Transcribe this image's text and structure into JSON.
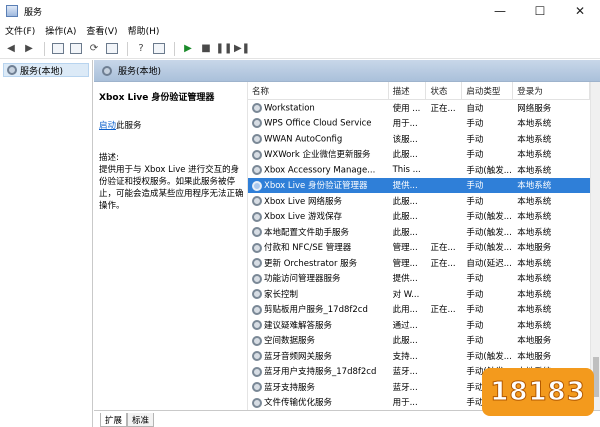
{
  "window": {
    "title": "服务",
    "min": "—",
    "max": "☐",
    "close": "✕"
  },
  "menu": [
    "文件(F)",
    "操作(A)",
    "查看(V)",
    "帮助(H)"
  ],
  "toolbar_icons": [
    "back-arrow-icon",
    "forward-arrow-icon",
    "console-tree-icon",
    "properties-icon",
    "refresh-icon",
    "export-list-icon",
    "help-icon",
    "show-hide-icon",
    "start-icon",
    "stop-icon",
    "pause-icon",
    "restart-icon"
  ],
  "tree": {
    "root_label": "服务(本地)"
  },
  "main": {
    "header": "服务(本地)"
  },
  "desc": {
    "title": "Xbox Live 身份验证管理器",
    "start_link": "启动",
    "start_suffix": "此服务",
    "label": "描述:",
    "text": "提供用于与 Xbox Live 进行交互的身份验证和授权服务。如果此服务被停止，可能会造成某些应用程序无法正确操作。"
  },
  "columns": [
    "名称",
    "描述",
    "状态",
    "启动类型",
    "登录为"
  ],
  "rows": [
    [
      "Workstation",
      "使用 ...",
      "正在...",
      "自动",
      "网络服务"
    ],
    [
      "WPS Office Cloud Service",
      "用于...",
      "",
      "手动",
      "本地系统"
    ],
    [
      "WWAN AutoConfig",
      "该服...",
      "",
      "手动",
      "本地系统"
    ],
    [
      "WXWork 企业微信更新服务",
      "此服...",
      "",
      "手动",
      "本地系统"
    ],
    [
      "Xbox Accessory Manage...",
      "This ...",
      "",
      "手动(触发...",
      "本地系统"
    ],
    [
      "Xbox Live 身份验证管理器",
      "提供...",
      "",
      "手动",
      "本地系统"
    ],
    [
      "Xbox Live 网络服务",
      "此服...",
      "",
      "手动",
      "本地系统"
    ],
    [
      "Xbox Live 游戏保存",
      "此服...",
      "",
      "手动(触发...",
      "本地系统"
    ],
    [
      "本地配置文件助手服务",
      "此服...",
      "",
      "手动(触发...",
      "本地系统"
    ],
    [
      "付款和 NFC/SE 管理器",
      "管理...",
      "正在...",
      "手动(触发...",
      "本地服务"
    ],
    [
      "更新 Orchestrator 服务",
      "管理...",
      "正在...",
      "自动(延迟...",
      "本地系统"
    ],
    [
      "功能访问管理器服务",
      "提供...",
      "",
      "手动",
      "本地系统"
    ],
    [
      "家长控制",
      "对 W...",
      "",
      "手动",
      "本地系统"
    ],
    [
      "剪贴板用户服务_17d8f2cd",
      "此用...",
      "正在...",
      "手动",
      "本地系统"
    ],
    [
      "建议疑难解答服务",
      "通过...",
      "",
      "手动",
      "本地系统"
    ],
    [
      "空间数据服务",
      "此服...",
      "",
      "手动",
      "本地服务"
    ],
    [
      "蓝牙音频网关服务",
      "支持...",
      "",
      "手动(触发...",
      "本地服务"
    ],
    [
      "蓝牙用户支持服务_17d8f2cd",
      "蓝牙...",
      "",
      "手动(触发...",
      "本地系统"
    ],
    [
      "蓝牙支持服务",
      "蓝牙...",
      "",
      "手动(触发...",
      "本地服务"
    ],
    [
      "文件传输优化服务",
      "用于...",
      "",
      "手动",
      "本地系统"
    ]
  ],
  "selected_row": 5,
  "tabs": [
    "扩展",
    "标准"
  ],
  "watermark": "18183",
  "colors": {
    "selection": "#2f7fd8",
    "link": "#0a5fcc",
    "header_bg": "#b9cbe2",
    "watermark_bg": "#f39a1d"
  }
}
